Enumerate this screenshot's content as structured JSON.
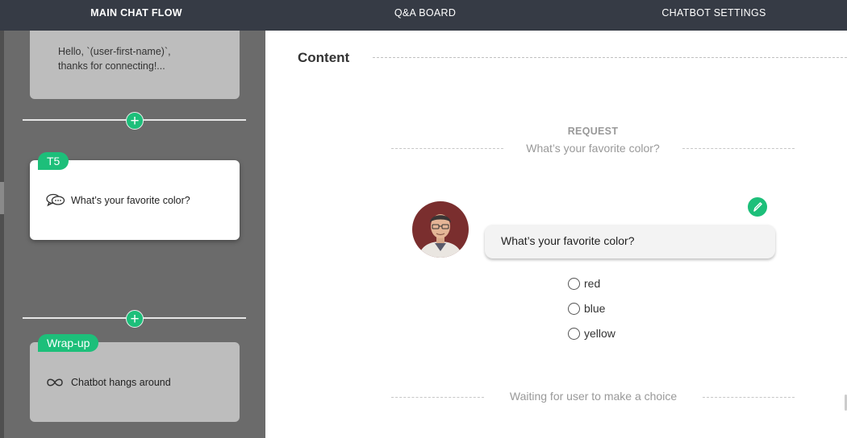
{
  "nav": {
    "tabs": [
      {
        "label": "MAIN CHAT FLOW",
        "active": true
      },
      {
        "label": "Q&A BOARD",
        "active": false
      },
      {
        "label": "CHATBOT SETTINGS",
        "active": false
      }
    ]
  },
  "flow": {
    "greeting_card": {
      "text_line1": "Hello, `(user-first-name)`,",
      "text_line2": "thanks for connecting!..."
    },
    "add_label": "+",
    "t5_card": {
      "tag": "T5",
      "message": "What’s your favorite color?",
      "icon": "chat-bubbles-icon"
    },
    "wrapup_card": {
      "tag": "Wrap-up",
      "message": "Chatbot hangs around",
      "icon": "infinity-icon"
    }
  },
  "content": {
    "section_title": "Content",
    "request_label": "REQUEST",
    "request_text": "What’s your favorite color?",
    "bubble_text": "What’s your favorite color?",
    "options": [
      "red",
      "blue",
      "yellow"
    ],
    "waiting_text": "Waiting for user to make a choice"
  },
  "colors": {
    "accent": "#1dbf7a",
    "nav_bg": "#363b45",
    "flow_bg": "#6b6b6b"
  }
}
